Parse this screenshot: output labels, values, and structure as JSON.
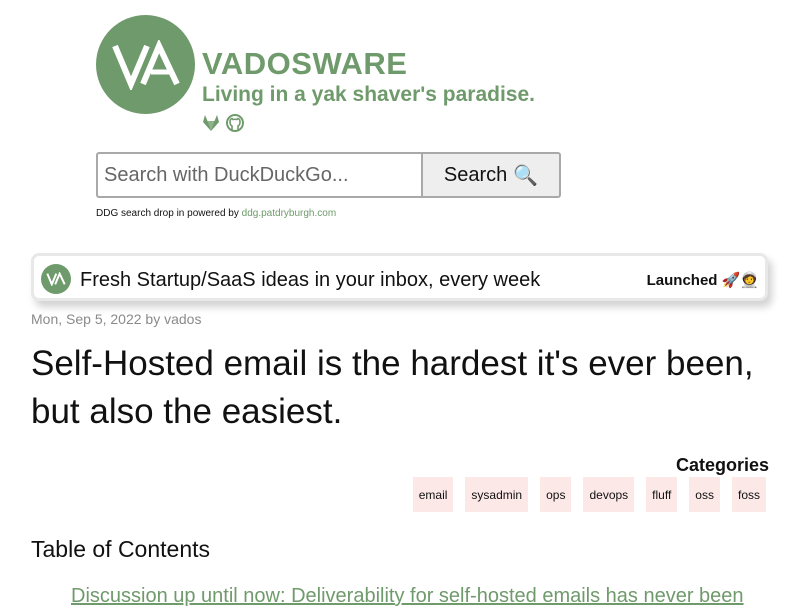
{
  "site": {
    "logo_text": "VA",
    "title": "VADOSWARE",
    "tagline": "Living in a yak shaver's paradise.",
    "social_icons": [
      "gitlab-icon",
      "github-icon"
    ],
    "accent_color": "#6f9a6b"
  },
  "search": {
    "placeholder": "Search with DuckDuckGo...",
    "button_label": "Search",
    "button_icon": "🔍",
    "note_text": "DDG search drop in powered by",
    "note_link": "ddg.patdryburgh.com"
  },
  "banner": {
    "logo_text": "VA",
    "text": "Fresh Startup/SaaS ideas in your inbox, every week",
    "badge": "Launched 🚀🧑‍🚀"
  },
  "post": {
    "date": "Mon, Sep 5, 2022",
    "by": "by",
    "author": "vados",
    "title": "Self-Hosted email is the hardest it's ever been, but also the easiest."
  },
  "categories": {
    "heading": "Categories",
    "items": [
      "email",
      "sysadmin",
      "ops",
      "devops",
      "fluff",
      "oss",
      "foss"
    ]
  },
  "toc": {
    "heading": "Table of Contents",
    "first_item": "Discussion up until now: Deliverability for self-hosted emails has never been"
  }
}
